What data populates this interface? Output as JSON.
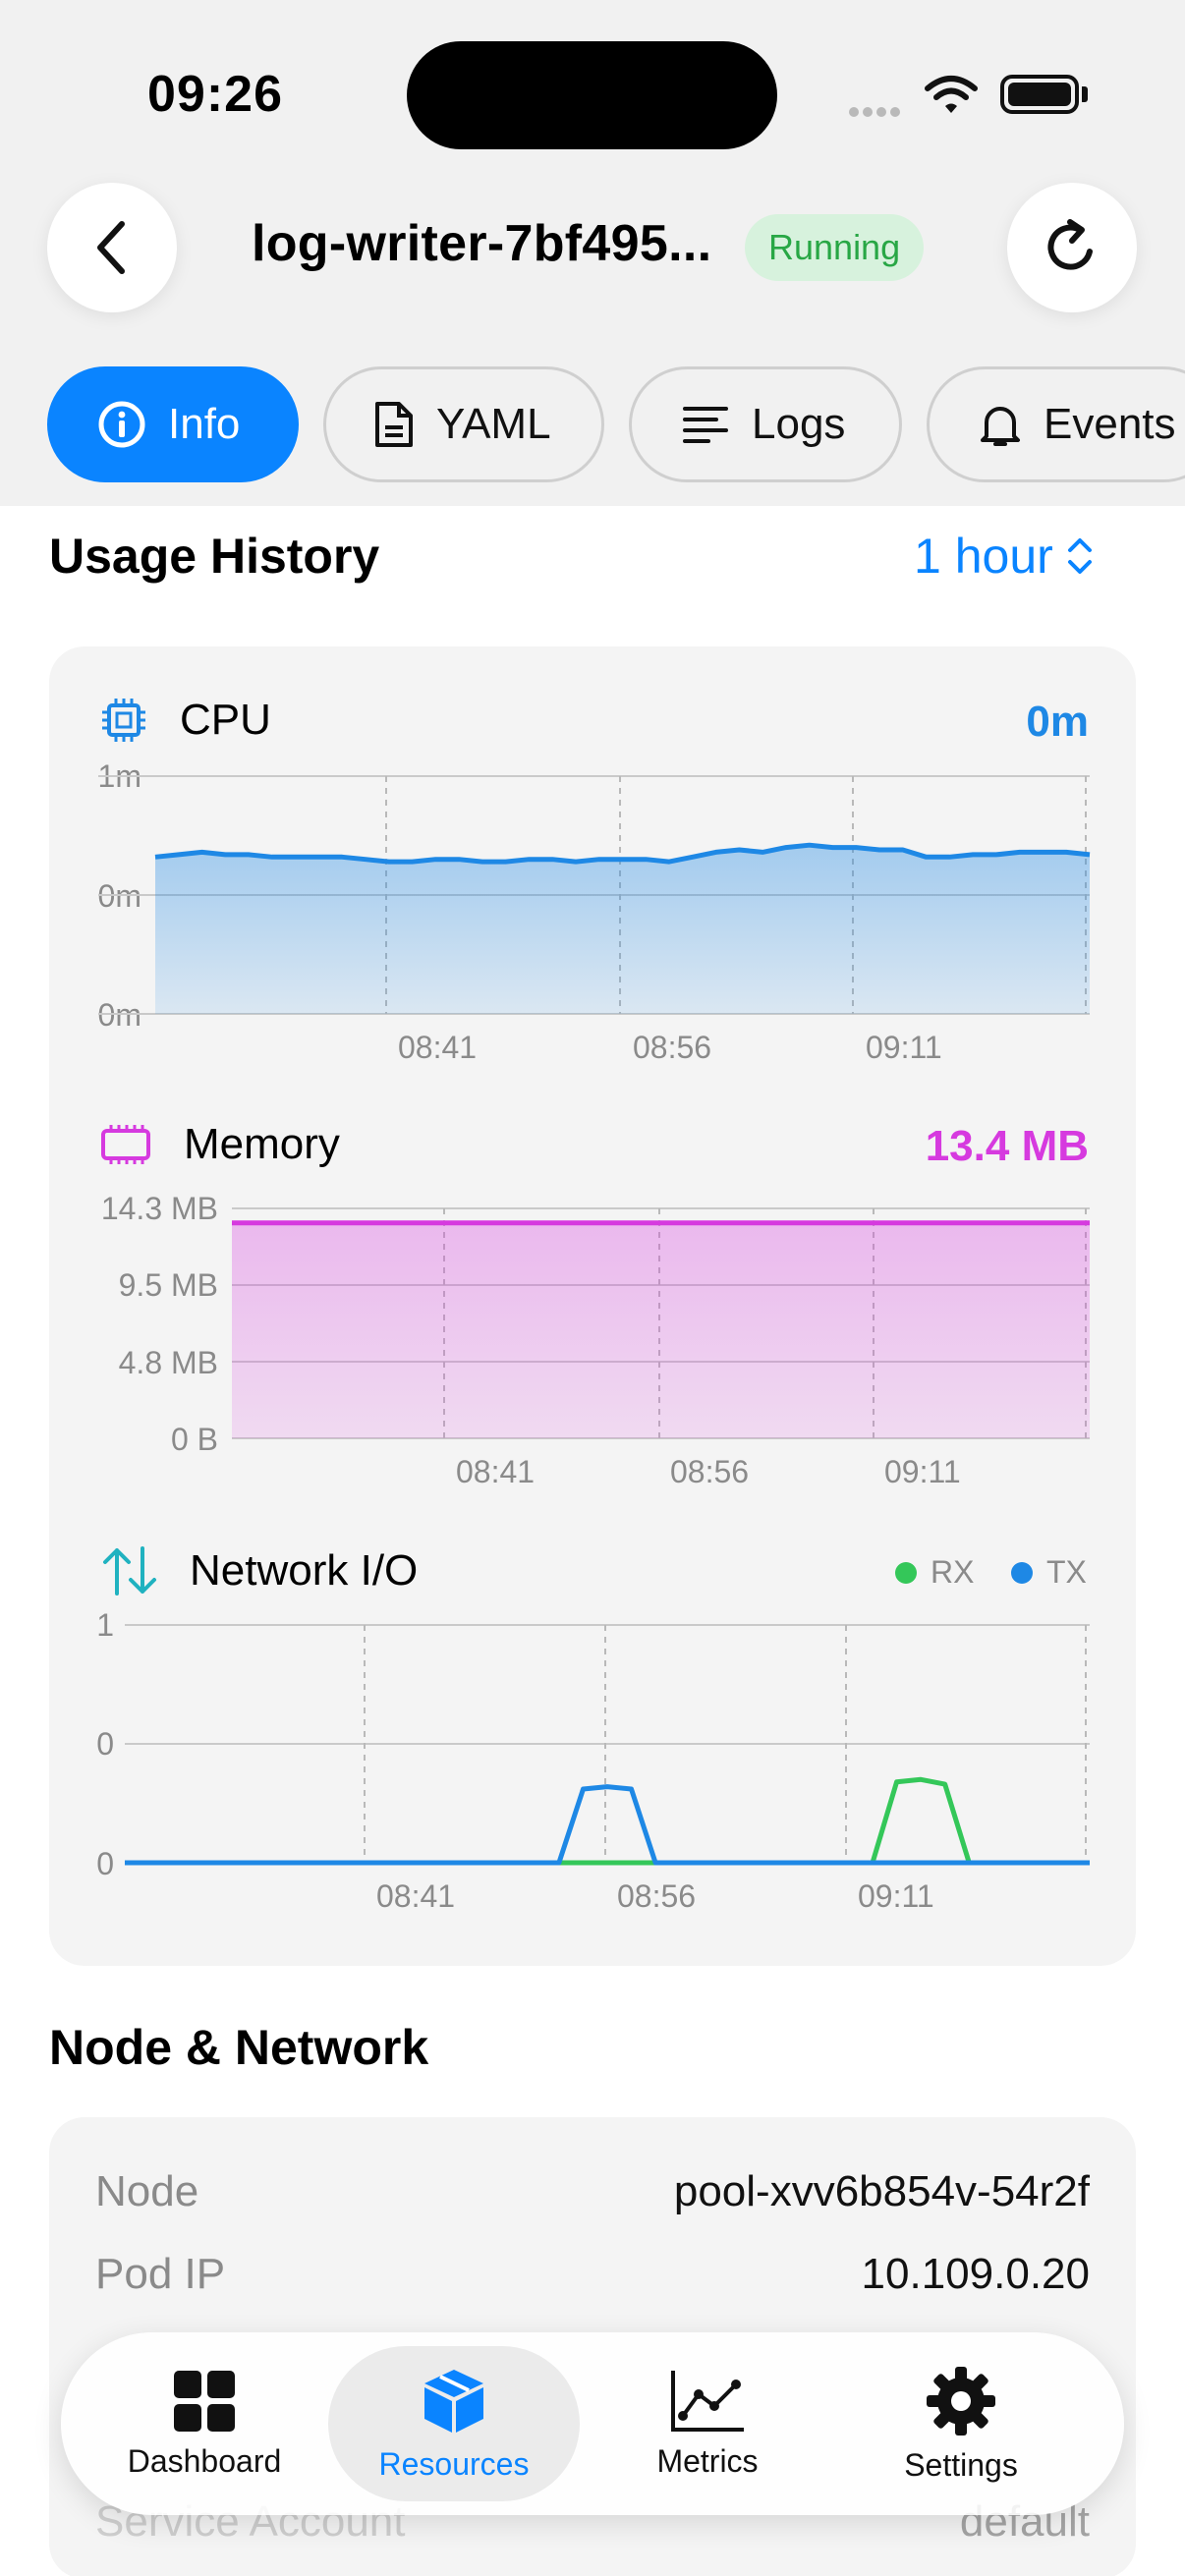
{
  "status_bar": {
    "time": "09:26"
  },
  "header": {
    "title": "log-writer-7bf495...",
    "status": "Running"
  },
  "tabs": [
    {
      "label": "Info",
      "icon": "info-circle-icon",
      "active": true
    },
    {
      "label": "YAML",
      "icon": "document-icon",
      "active": false
    },
    {
      "label": "Logs",
      "icon": "text-lines-icon",
      "active": false
    },
    {
      "label": "Events",
      "icon": "bell-icon",
      "active": false
    }
  ],
  "usage_history": {
    "title": "Usage History",
    "range": "1 hour",
    "cpu": {
      "title": "CPU",
      "value": "0m",
      "y_labels": [
        "1m",
        "0m",
        "0m"
      ],
      "x_labels": [
        "08:41",
        "08:56",
        "09:11"
      ]
    },
    "memory": {
      "title": "Memory",
      "value": "13.4 MB",
      "y_labels": [
        "14.3 MB",
        "9.5 MB",
        "4.8 MB",
        "0 B"
      ],
      "x_labels": [
        "08:41",
        "08:56",
        "09:11"
      ]
    },
    "network": {
      "title": "Network I/O",
      "y_labels": [
        "1",
        "0",
        "0"
      ],
      "x_labels": [
        "08:41",
        "08:56",
        "09:11"
      ],
      "legend": {
        "rx": "RX",
        "tx": "TX"
      }
    }
  },
  "chart_data": [
    {
      "type": "area",
      "title": "CPU",
      "y_ticks": [
        "1m",
        "0m",
        "0m"
      ],
      "x_ticks": [
        "08:41",
        "08:56",
        "09:11"
      ],
      "series": [
        {
          "values": [
            0.66,
            0.67,
            0.68,
            0.67,
            0.67,
            0.66,
            0.66,
            0.66,
            0.66,
            0.65,
            0.64,
            0.64,
            0.65,
            0.65,
            0.64,
            0.64,
            0.65,
            0.65,
            0.64,
            0.65,
            0.65,
            0.65,
            0.64,
            0.66,
            0.68,
            0.69,
            0.68,
            0.7,
            0.71,
            0.7,
            0.7,
            0.69,
            0.69,
            0.66,
            0.66,
            0.67,
            0.67,
            0.68,
            0.68,
            0.68,
            0.67
          ]
        }
      ],
      "color": "#1e88e5"
    },
    {
      "type": "area",
      "title": "Memory",
      "unit": "MB",
      "y_ticks": [
        "14.3 MB",
        "9.5 MB",
        "4.8 MB",
        "0 B"
      ],
      "x_ticks": [
        "08:41",
        "08:56",
        "09:11"
      ],
      "ylim": [
        0,
        14.3
      ],
      "series": [
        {
          "values": [
            13.4,
            13.4,
            13.4,
            13.4,
            13.4,
            13.4,
            13.4,
            13.4,
            13.4,
            13.4,
            13.4
          ]
        }
      ],
      "color": "#d63adf"
    },
    {
      "type": "line",
      "title": "Network I/O",
      "y_ticks": [
        "1",
        "0",
        "0"
      ],
      "x_ticks": [
        "08:41",
        "08:56",
        "09:11"
      ],
      "x": [
        0,
        1,
        2,
        3,
        4,
        5,
        6,
        7,
        8,
        9,
        10,
        11,
        12,
        13,
        14,
        15,
        16,
        17,
        18,
        19,
        20,
        21,
        22,
        23,
        24,
        25,
        26,
        27,
        28,
        29,
        30,
        31,
        32,
        33,
        34,
        35,
        36,
        37,
        38,
        39,
        40
      ],
      "series": [
        {
          "name": "RX",
          "color": "#34c759",
          "values": [
            0,
            0,
            0,
            0,
            0,
            0,
            0,
            0,
            0,
            0,
            0,
            0,
            0,
            0,
            0,
            0,
            0,
            0,
            0,
            0,
            0,
            0,
            0,
            0,
            0,
            0,
            0,
            0,
            0,
            0,
            0,
            0,
            0.34,
            0.35,
            0.33,
            0,
            0,
            0,
            0,
            0,
            0
          ]
        },
        {
          "name": "TX",
          "color": "#1e88e5",
          "values": [
            0,
            0,
            0,
            0,
            0,
            0,
            0,
            0,
            0,
            0,
            0,
            0,
            0,
            0,
            0,
            0,
            0,
            0,
            0,
            0.31,
            0.32,
            0.31,
            0,
            0,
            0,
            0,
            0,
            0,
            0,
            0,
            0,
            0,
            0,
            0,
            0,
            0,
            0,
            0,
            0,
            0,
            0
          ]
        }
      ]
    }
  ],
  "node_network": {
    "title": "Node & Network",
    "rows": [
      {
        "label": "Node",
        "value": "pool-xvv6b854v-54r2f"
      },
      {
        "label": "Pod IP",
        "value": "10.109.0.20"
      },
      {
        "label": "Service Account",
        "value": "default"
      }
    ]
  },
  "bottom_nav": [
    {
      "label": "Dashboard",
      "icon": "grid-icon",
      "active": false
    },
    {
      "label": "Resources",
      "icon": "cube-icon",
      "active": true
    },
    {
      "label": "Metrics",
      "icon": "line-chart-icon",
      "active": false
    },
    {
      "label": "Settings",
      "icon": "gear-icon",
      "active": false
    }
  ],
  "colors": {
    "accent": "#0a84ff",
    "running_bg": "#d7f2dd",
    "running_text": "#28a745",
    "cpu": "#1e88e5",
    "memory": "#d63adf",
    "network_icon": "#20b2c0",
    "rx": "#34c759",
    "tx": "#1e88e5"
  }
}
